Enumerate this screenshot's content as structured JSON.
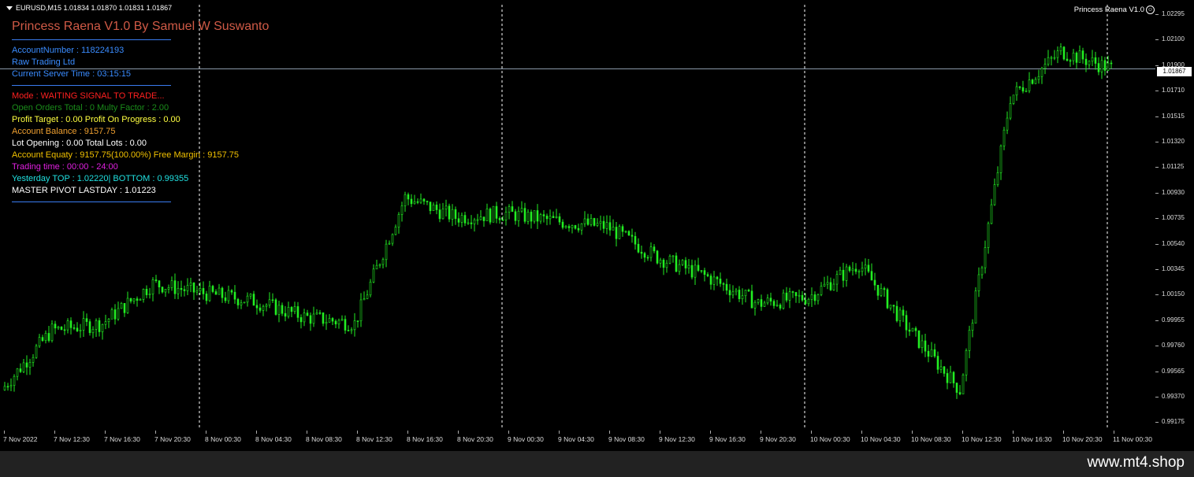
{
  "header": {
    "symbol_info": "EURUSD,M15  1.01834 1.01870 1.01831 1.01867",
    "ea_label": "Princess Raena V1.0",
    "smile_glyph": "☺"
  },
  "panel": {
    "title": "Princess Raena V1.0 By Samuel W Suswanto",
    "lines_top": [
      {
        "text": "AccountNumber : 118224193",
        "color": "#3a8cff"
      },
      {
        "text": "Raw Trading Ltd",
        "color": "#3a8cff"
      },
      {
        "text": "Current Server Time : 03:15:15",
        "color": "#3a8cff"
      }
    ],
    "lines_status": [
      {
        "text": "Mode : WAITING SIGNAL TO TRADE...",
        "color": "#ff2020"
      },
      {
        "text": "Open Orders Total : 0 Multy Factor : 2.00",
        "color": "#1a8c1a"
      },
      {
        "text": "Profit Target : 0.00 Profit On Progress  : 0.00",
        "color": "#ffff40"
      },
      {
        "text": "Account Balance : 9157.75",
        "color": "#f0a030"
      },
      {
        "text": "Lot Opening : 0.00  Total Lots : 0.00",
        "color": "#ffffff"
      },
      {
        "text": "Account Equaty : 9157.75(100.00%) Free Margin  : 9157.75",
        "color": "#f0c000"
      },
      {
        "text": "Trading time : 00:00 - 24:00",
        "color": "#e020e0"
      },
      {
        "text": "Yesterday TOP : 1.02220| BOTTOM  : 0.99355",
        "color": "#20e0e0"
      },
      {
        "text": "MASTER PIVOT LASTDAY : 1.01223",
        "color": "#ffffff"
      }
    ]
  },
  "price_axis": {
    "ticks": [
      "1.02295",
      "1.02100",
      "1.01900",
      "1.01710",
      "1.01515",
      "1.01320",
      "1.01125",
      "1.00930",
      "1.00735",
      "1.00540",
      "1.00345",
      "1.00150",
      "0.99955",
      "0.99760",
      "0.99565",
      "0.99370",
      "0.99175"
    ],
    "current_price": "1.01867"
  },
  "time_axis": {
    "labels": [
      "7 Nov 2022",
      "7 Nov 12:30",
      "7 Nov 16:30",
      "7 Nov 20:30",
      "8 Nov 00:30",
      "8 Nov 04:30",
      "8 Nov 08:30",
      "8 Nov 12:30",
      "8 Nov 16:30",
      "8 Nov 20:30",
      "9 Nov 00:30",
      "9 Nov 04:30",
      "9 Nov 08:30",
      "9 Nov 12:30",
      "9 Nov 16:30",
      "9 Nov 20:30",
      "10 Nov 00:30",
      "10 Nov 04:30",
      "10 Nov 08:30",
      "10 Nov 12:30",
      "10 Nov 16:30",
      "10 Nov 20:30",
      "11 Nov 00:30"
    ]
  },
  "chart_data": {
    "type": "line",
    "symbol": "EURUSD",
    "timeframe": "M15",
    "ylim": [
      0.9915,
      1.0235
    ],
    "current_price": 1.01867,
    "x": [
      "7 Nov 2022",
      "7 Nov 12:30",
      "7 Nov 16:30",
      "7 Nov 20:30",
      "8 Nov 00:30",
      "8 Nov 04:30",
      "8 Nov 08:30",
      "8 Nov 12:30",
      "8 Nov 16:30",
      "8 Nov 20:30",
      "9 Nov 00:30",
      "9 Nov 04:30",
      "9 Nov 08:30",
      "9 Nov 12:30",
      "9 Nov 16:30",
      "9 Nov 20:30",
      "10 Nov 00:30",
      "10 Nov 04:30",
      "10 Nov 08:30",
      "10 Nov 12:30",
      "10 Nov 16:30",
      "10 Nov 20:30",
      "11 Nov 00:30"
    ],
    "series": [
      {
        "values": [
          0.9945,
          0.999,
          0.9995,
          1.0025,
          1.0018,
          1.0012,
          1.0,
          0.9995,
          1.009,
          1.0075,
          1.0078,
          1.0072,
          1.0068,
          1.0045,
          1.003,
          1.001,
          1.0015,
          1.004,
          0.999,
          0.9945,
          1.0165,
          1.02,
          1.0187
        ],
        "color": "#22ee22"
      }
    ],
    "day_separators": [
      "8 Nov",
      "9 Nov",
      "10 Nov",
      "11 Nov"
    ],
    "colors": {
      "candle": "#22ee22",
      "background": "#000000",
      "separator": "#ffffff"
    }
  },
  "footer": {
    "watermark": "www.mt4.shop"
  }
}
